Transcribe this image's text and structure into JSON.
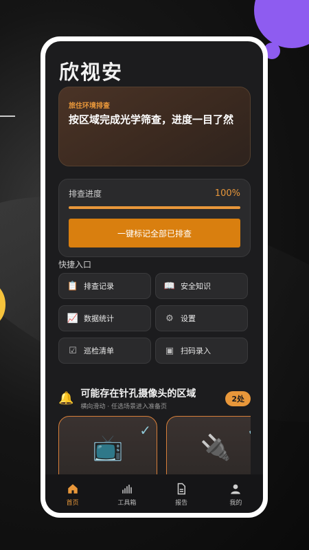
{
  "app": {
    "title": "欣视安"
  },
  "banner": {
    "tag": "旅住环境排查",
    "text": "按区域完成光学筛查，进度一目了然"
  },
  "progress": {
    "label": "排查进度",
    "value_text": "100%",
    "fraction": 1.0,
    "button_label": "一键标记全部已排查"
  },
  "quick": {
    "title": "快捷入口",
    "items": [
      {
        "label": "排查记录",
        "icon": "clipboard-icon",
        "glyph": "📋"
      },
      {
        "label": "安全知识",
        "icon": "book-icon",
        "glyph": "📖"
      },
      {
        "label": "数据统计",
        "icon": "chart-icon",
        "glyph": "📈"
      },
      {
        "label": "设置",
        "icon": "gear-icon",
        "glyph": "⚙"
      },
      {
        "label": "巡检清单",
        "icon": "checklist-icon",
        "glyph": "☑"
      },
      {
        "label": "扫码录入",
        "icon": "scan-icon",
        "glyph": "▣"
      }
    ]
  },
  "hidden_areas": {
    "title": "可能存在针孔摄像头的区域",
    "subtitle": "横向滑动 · 任选场景进入准备页",
    "count_badge": "2处",
    "cards": [
      {
        "icon": "tv-icon",
        "glyph": "📺",
        "checked": true
      },
      {
        "icon": "plug-icon",
        "glyph": "🔌",
        "checked": true
      }
    ]
  },
  "tabbar": {
    "tabs": [
      {
        "label": "首页",
        "icon": "home-icon",
        "active": true
      },
      {
        "label": "工具箱",
        "icon": "toolbox-icon",
        "active": false
      },
      {
        "label": "报告",
        "icon": "report-icon",
        "active": false
      },
      {
        "label": "我的",
        "icon": "profile-icon",
        "active": false
      }
    ]
  },
  "colors": {
    "accent": "#e8973a",
    "button": "#d97f0f",
    "background": "#1c1c1e",
    "purple": "#8e5cf0"
  }
}
